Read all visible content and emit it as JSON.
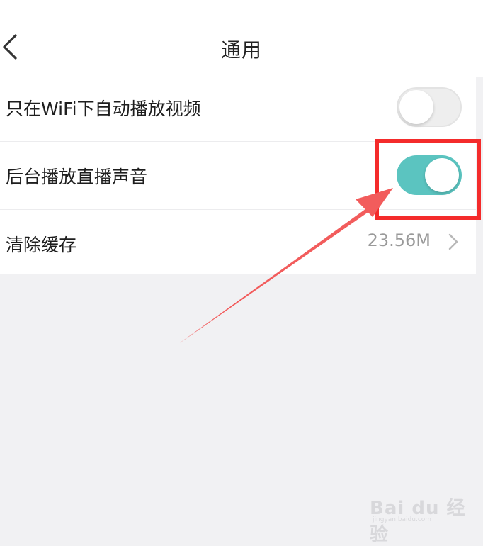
{
  "header": {
    "title": "通用",
    "back_icon": "chevron-left-icon"
  },
  "settings": {
    "wifi_autoplay": {
      "label": "只在WiFi下自动播放视频",
      "enabled": false
    },
    "background_audio": {
      "label": "后台播放直播声音",
      "enabled": true
    },
    "clear_cache": {
      "label": "清除缓存",
      "value": "23.56M",
      "icon": "chevron-right-icon"
    }
  },
  "colors": {
    "toggle_on": "#5bc4c0",
    "toggle_off": "#eeeeee",
    "highlight": "#f42b2b",
    "background": "#f1f1f3"
  },
  "watermark": {
    "logo": "Bai du 经验",
    "url": "jingyan.baidu.com"
  }
}
